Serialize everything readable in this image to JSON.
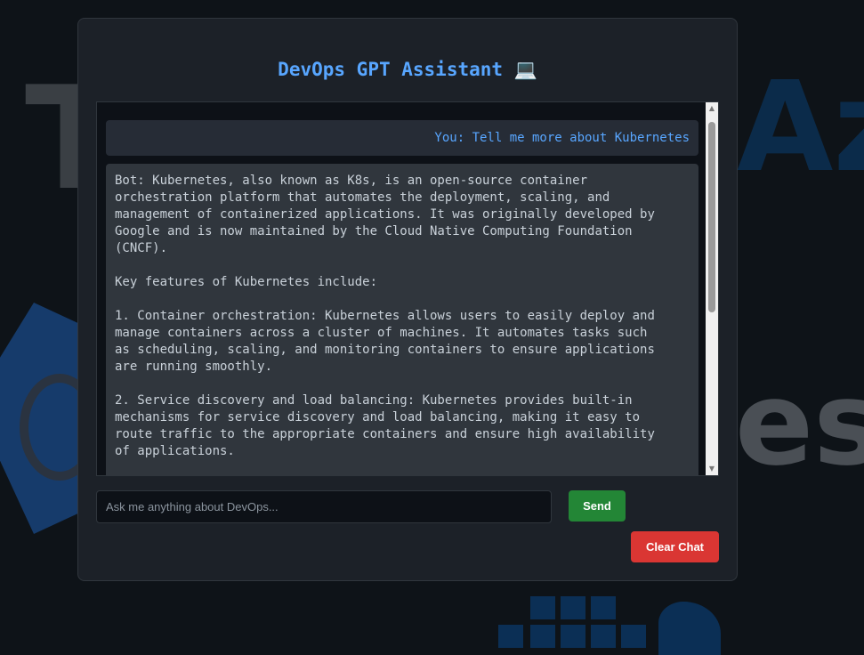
{
  "app": {
    "title": "DevOps GPT Assistant 💻"
  },
  "chat": {
    "messages": [
      {
        "role": "user",
        "text": "You: Tell me more about Kubernetes"
      },
      {
        "role": "bot",
        "text": "Bot: Kubernetes, also known as K8s, is an open-source container\norchestration platform that automates the deployment, scaling, and\nmanagement of containerized applications. It was originally developed by\nGoogle and is now maintained by the Cloud Native Computing Foundation\n(CNCF).\n\nKey features of Kubernetes include:\n\n1. Container orchestration: Kubernetes allows users to easily deploy and\nmanage containers across a cluster of machines. It automates tasks such\nas scheduling, scaling, and monitoring containers to ensure applications\nare running smoothly.\n\n2. Service discovery and load balancing: Kubernetes provides built-in\nmechanisms for service discovery and load balancing, making it easy to\nroute traffic to the appropriate containers and ensure high availability\nof applications."
      }
    ]
  },
  "input": {
    "placeholder": "Ask me anything about DevOps...",
    "value": ""
  },
  "buttons": {
    "send_label": "Send",
    "clear_label": "Clear Chat"
  },
  "colors": {
    "accent": "#58a6ff",
    "send": "#238636",
    "clear": "#da3633",
    "panel": "#1c2128"
  },
  "background": {
    "words": [
      "T",
      "Az",
      "es"
    ]
  }
}
